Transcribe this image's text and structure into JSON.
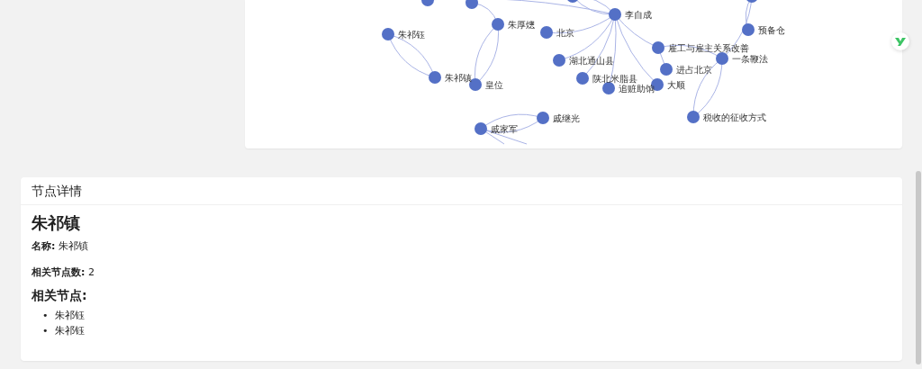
{
  "graph": {
    "nodes": [
      {
        "label": "李自成"
      },
      {
        "label": "朱厚熜"
      },
      {
        "label": "预备仓"
      },
      {
        "label": "朱祁钰"
      },
      {
        "label": "北京"
      },
      {
        "label": "雇工与雇主关系改善"
      },
      {
        "label": "一条鞭法"
      },
      {
        "label": "湖北通山县"
      },
      {
        "label": "进占北京"
      },
      {
        "label": "朱祁镇"
      },
      {
        "label": "陕北米脂县"
      },
      {
        "label": "皇位"
      },
      {
        "label": "追赃助饷"
      },
      {
        "label": "大顺"
      },
      {
        "label": "戚继光"
      },
      {
        "label": "税收的征收方式"
      },
      {
        "label": "戚家军"
      }
    ]
  },
  "details": {
    "title": "节点详情",
    "node_name": "朱祁镇",
    "fields": [
      {
        "label": "名称:",
        "value": "朱祁镇"
      },
      {
        "label": "相关节点数:",
        "value": "2"
      }
    ],
    "related_heading": "相关节点:",
    "related": [
      {
        "bullet": "•",
        "text": "朱祁钰"
      },
      {
        "bullet": "•",
        "text": "朱祁钰"
      }
    ]
  }
}
